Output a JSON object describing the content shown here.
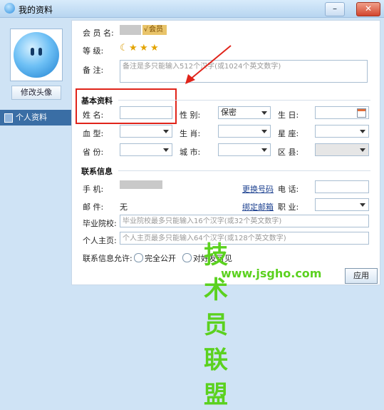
{
  "window": {
    "title": "我的资料",
    "min_label": "–",
    "close_label": "✕"
  },
  "left": {
    "edit_avatar": "修改头像",
    "nav_personal": "个人资料"
  },
  "member": {
    "name_label": "会 员 名:",
    "vip_badge": "会员",
    "level_label": "等      级:",
    "level_icons": [
      "moon-icon",
      "star-icon",
      "star-icon",
      "star-icon"
    ],
    "note_label": "备      注:",
    "note_placeholder": "备注是多只能输入512个汉字(或1024个英文数字)"
  },
  "basic": {
    "title": "基本资料",
    "name_label": "姓    名:",
    "gender_label": "性    别:",
    "gender_value": "保密",
    "birthday_label": "生    日:",
    "blood_label": "血    型:",
    "zodiac_label": "生    肖:",
    "constellation_label": "星    座:",
    "province_label": "省    份:",
    "city_label": "城    市:",
    "district_label": "区    县:"
  },
  "contact": {
    "title": "联系信息",
    "phone_label": "手    机:",
    "change_number": "更换号码",
    "tel_label": "电    话:",
    "email_label": "邮    件:",
    "email_value": "无",
    "bind_email": "绑定邮箱",
    "job_label": "职    业:",
    "school_label": "毕业院校:",
    "school_placeholder": "毕业院校最多只能输入16个汉字(或32个英文数字)",
    "homepage_label": "个人主页:",
    "homepage_placeholder": "个人主页最多只能输入64个汉字(或128个英文数字)",
    "allow_label": "联系信息允许:",
    "opt_public": "完全公开",
    "opt_friends": "对好友可见"
  },
  "buttons": {
    "apply": "应用"
  },
  "watermark": {
    "cn": "技术员联盟",
    "url": "www.jsgho.com"
  },
  "colors": {
    "highlight": "#e0241a",
    "watermark": "#5bd11f",
    "nav_selected": "#3a6ea5"
  }
}
